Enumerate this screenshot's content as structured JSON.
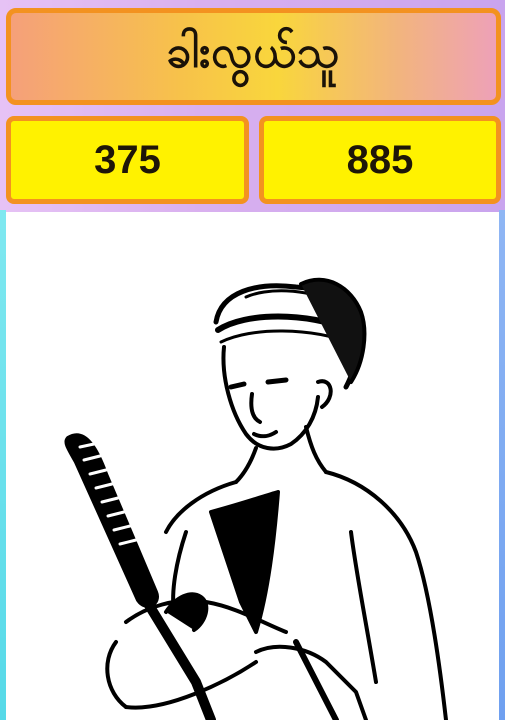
{
  "title": "ခါးလွယ်သူ",
  "numbers": {
    "left": "375",
    "right": "885"
  },
  "illustration": {
    "icon": "man-with-sword-illustration"
  },
  "colors": {
    "border": "#f39220",
    "number_background": "#fff200",
    "panel_background": "#ffffff"
  }
}
